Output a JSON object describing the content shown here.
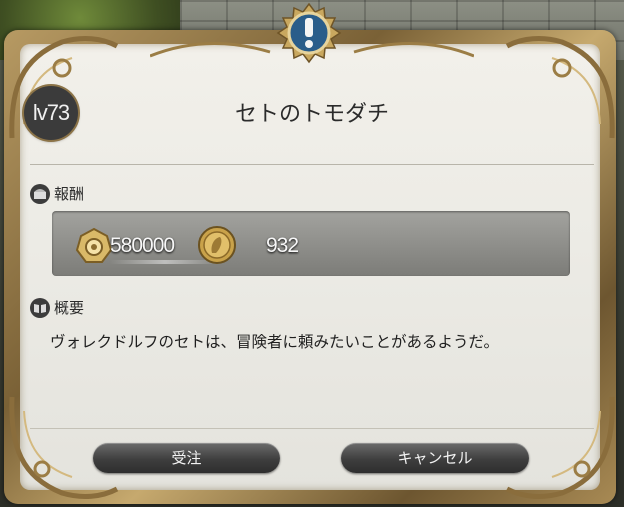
{
  "dialog": {
    "level": "lv73",
    "title": "セトのトモダチ",
    "emblem_icon": "exclamation-emblem-icon"
  },
  "reward": {
    "label": "報酬",
    "icon": "chest-icon",
    "gil_icon": "gil-icon",
    "gil_amount": "580000",
    "coin_icon": "gold-coin-icon",
    "coin_amount": "932"
  },
  "summary": {
    "label": "概要",
    "icon": "book-icon",
    "text": "ヴォレクドルフのセトは、冒険者に頼みたいことがあるようだ。"
  },
  "buttons": {
    "accept": "受注",
    "cancel": "キャンセル"
  },
  "colors": {
    "frame_gold": "#b79a63",
    "panel_bg": "#ecebe5",
    "button_dark": "#3e3e3e",
    "emblem_blue": "#2a5d8a"
  }
}
